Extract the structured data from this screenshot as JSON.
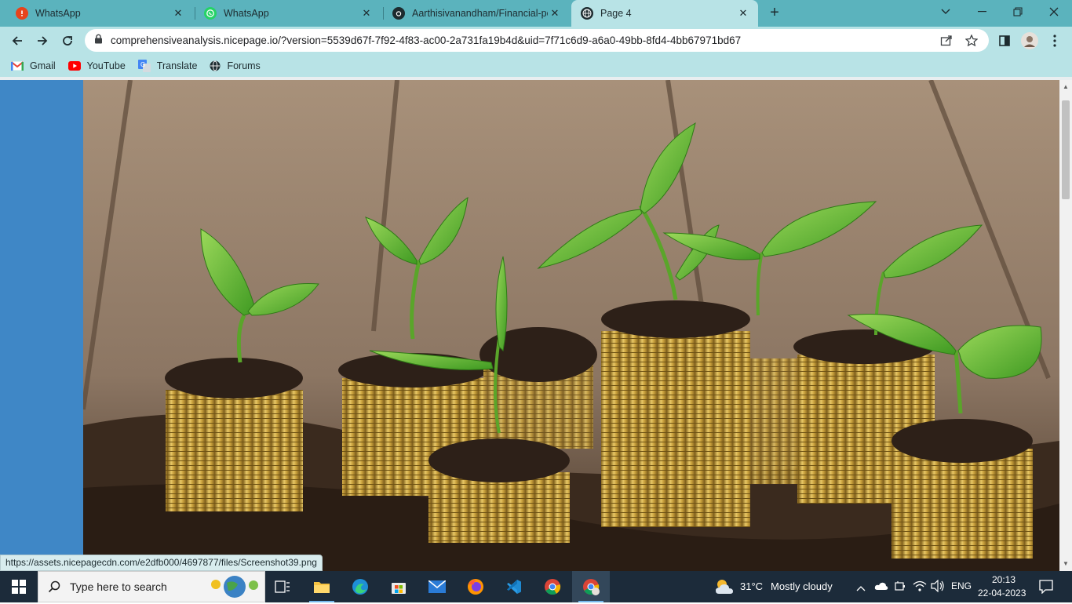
{
  "tabs": [
    {
      "title": "WhatsApp",
      "icon": "alert-icon"
    },
    {
      "title": "WhatsApp",
      "icon": "whatsapp-icon"
    },
    {
      "title": "Aarthisivanandham/Financial-pe",
      "icon": "github-icon"
    },
    {
      "title": "Page 4",
      "icon": "globe-icon"
    }
  ],
  "toolbar": {
    "url": "comprehensiveanalysis.nicepage.io/?version=5539d67f-7f92-4f83-ac00-2a731fa19b4d&uid=7f71c6d9-a6a0-49bb-8fd4-4bb67971bd67"
  },
  "bookmarks": [
    {
      "label": "Gmail"
    },
    {
      "label": "YouTube"
    },
    {
      "label": "Translate"
    },
    {
      "label": "Forums"
    }
  ],
  "status_link": "https://assets.nicepagecdn.com/e2dfb000/4697877/files/Screenshot39.png",
  "taskbar": {
    "search_placeholder": "Type here to search",
    "weather_temp": "31°C",
    "weather_text": "Mostly cloudy",
    "language": "ENG",
    "time": "20:13",
    "date": "22-04-2023"
  },
  "colors": {
    "tab_strip": "#5bb3bd",
    "toolbar": "#b8e3e6",
    "sidebar_blue": "#3f87c6",
    "taskbar": "#1c2b3a"
  }
}
